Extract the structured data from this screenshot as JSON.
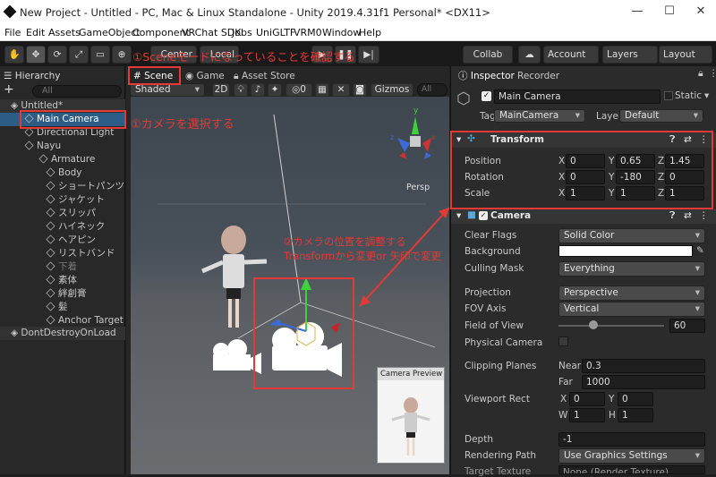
{
  "window": {
    "title": "New Project - Untitled - PC, Mac & Linux Standalone - Unity 2019.4.31f1 Personal* <DX11>",
    "minimize": "—",
    "maximize": "☐",
    "close": "✕"
  },
  "menu": [
    "File",
    "Edit",
    "Assets",
    "GameObject",
    "Component",
    "VRChat SDK",
    "Jobs",
    "UniGLTF",
    "VRM0",
    "Window",
    "Help"
  ],
  "toolbar": {
    "center": "Center",
    "local": "Local",
    "collab": "Collab",
    "account": "Account",
    "layers": "Layers",
    "layout": "Layout"
  },
  "hierarchy": {
    "tab": "Hierarchy",
    "add": "+",
    "search": "All",
    "items": [
      {
        "label": "Untitled*"
      },
      {
        "label": "Main Camera"
      },
      {
        "label": "Directional Light"
      },
      {
        "label": "Nayu"
      },
      {
        "label": "Armature"
      },
      {
        "label": "Body"
      },
      {
        "label": "ショートパンツ"
      },
      {
        "label": "ジャケット"
      },
      {
        "label": "スリッパ"
      },
      {
        "label": "ハイネック"
      },
      {
        "label": "ヘアピン"
      },
      {
        "label": "リストバンド"
      },
      {
        "label": "下着"
      },
      {
        "label": "素体"
      },
      {
        "label": "絆創膏"
      },
      {
        "label": "髪"
      },
      {
        "label": "Anchor Target"
      },
      {
        "label": "DontDestroyOnLoad"
      }
    ]
  },
  "scene": {
    "tabs": [
      "Scene",
      "Game",
      "Asset Store"
    ],
    "shading": "Shaded",
    "mode2d": "2D",
    "hidden_count": "0",
    "gizmos": "Gizmos",
    "search": "All",
    "persp": "Persp",
    "preview_title": "Camera Preview"
  },
  "inspector": {
    "tabs": [
      "Inspector",
      "Recorder"
    ],
    "object_name": "Main Camera",
    "static_label": "Static",
    "tag_label": "Tag",
    "tag_value": "MainCamera",
    "layer_label": "Layer",
    "layer_value": "Default",
    "transform": {
      "title": "Transform",
      "rows": [
        {
          "label": "Position",
          "x": "0",
          "y": "0.65",
          "z": "1.45"
        },
        {
          "label": "Rotation",
          "x": "0",
          "y": "-180",
          "z": "0"
        },
        {
          "label": "Scale",
          "x": "1",
          "y": "1",
          "z": "1"
        }
      ],
      "axis_x": "X",
      "axis_y": "Y",
      "axis_z": "Z"
    },
    "camera": {
      "title": "Camera",
      "clear_flags_label": "Clear Flags",
      "clear_flags": "Solid Color",
      "background_label": "Background",
      "culling_label": "Culling Mask",
      "culling": "Everything",
      "projection_label": "Projection",
      "projection": "Perspective",
      "fov_axis_label": "FOV Axis",
      "fov_axis": "Vertical",
      "fov_label": "Field of View",
      "fov": "60",
      "fov_fraction": 0.33,
      "physical_label": "Physical Camera",
      "clipping_label": "Clipping Planes",
      "near_label": "Near",
      "near": "0.3",
      "far_label": "Far",
      "far": "1000",
      "viewport_label": "Viewport Rect",
      "vx_label": "X",
      "vx": "0",
      "vy_label": "Y",
      "vy": "0",
      "vw_label": "W",
      "vw": "1",
      "vh_label": "H",
      "vh": "1",
      "depth_label": "Depth",
      "depth": "-1",
      "rendering_label": "Rendering Path",
      "rendering": "Use Graphics Settings",
      "target_label": "Target Texture",
      "target": "None (Render Texture)"
    }
  },
  "annotations": {
    "scene_note": "①Sceneモードになっていることを確認する",
    "select_note": "①カメラを選択する",
    "transform_note_1": "②カメラの位置を調整する",
    "transform_note_2": "Transformから変更or 矢印で変更"
  },
  "colors": {
    "annotation": "#e53935",
    "accent": "#3d7bd6",
    "selection": "#2c5d87"
  }
}
